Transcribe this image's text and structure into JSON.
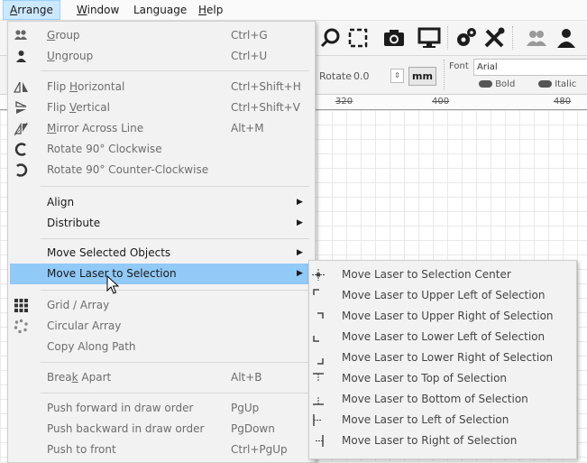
{
  "menubar": {
    "items": [
      {
        "label": "Arrange",
        "mnemonic": "A",
        "rest": "rrange"
      },
      {
        "label": "Window",
        "mnemonic": "W",
        "rest": "indow"
      },
      {
        "label": "Language"
      },
      {
        "label": "Help",
        "mnemonic": "H",
        "rest": "elp"
      }
    ]
  },
  "props": {
    "rotate_label": "Rotate",
    "rotate_value": "0.0",
    "unit_button": "mm",
    "font_label": "Font",
    "font_value": "Arial",
    "bold_label": "Bold",
    "italic_label": "Italic"
  },
  "ruler": {
    "ticks": [
      "320",
      "400",
      "480"
    ]
  },
  "arrange_menu": {
    "items": [
      {
        "pre": "",
        "mn": "G",
        "post": "roup",
        "shortcut": "Ctrl+G",
        "icon": "group-icon",
        "disabled": true
      },
      {
        "pre": "",
        "mn": "U",
        "post": "ngroup",
        "shortcut": "Ctrl+U",
        "icon": "ungroup-icon",
        "disabled": true
      },
      {
        "pre": "Flip ",
        "mn": "H",
        "post": "orizontal",
        "shortcut": "Ctrl+Shift+H",
        "icon": "flip-horizontal-icon",
        "disabled": true
      },
      {
        "pre": "Flip ",
        "mn": "V",
        "post": "ertical",
        "shortcut": "Ctrl+Shift+V",
        "icon": "flip-vertical-icon",
        "disabled": true
      },
      {
        "pre": "",
        "mn": "M",
        "post": "irror Across Line",
        "shortcut": "Alt+M",
        "icon": "mirror-icon",
        "disabled": true
      },
      {
        "pre": "Rotate 90° Clockwise",
        "mn": "",
        "post": "",
        "shortcut": "",
        "icon": "rotate-clockwise-icon",
        "disabled": true
      },
      {
        "pre": "Rotate 90° Counter-Clockwise",
        "mn": "",
        "post": "",
        "shortcut": "",
        "icon": "rotate-counter-clockwise-icon",
        "disabled": true
      },
      {
        "pre": "Align",
        "mn": "",
        "post": "",
        "shortcut": "",
        "icon": "",
        "disabled": false,
        "submenu": true
      },
      {
        "pre": "Distribute",
        "mn": "",
        "post": "",
        "shortcut": "",
        "icon": "",
        "disabled": false,
        "submenu": true
      },
      {
        "pre": "Move Selected Objects",
        "mn": "",
        "post": "",
        "shortcut": "",
        "icon": "",
        "disabled": false,
        "submenu": true
      },
      {
        "pre": "Move Laser to Selection",
        "mn": "",
        "post": "",
        "shortcut": "",
        "icon": "",
        "disabled": false,
        "submenu": true,
        "highlighted": true
      },
      {
        "pre": "Grid / Array",
        "mn": "",
        "post": "",
        "shortcut": "",
        "icon": "grid-array-icon",
        "disabled": true
      },
      {
        "pre": "Circular Array",
        "mn": "",
        "post": "",
        "shortcut": "",
        "icon": "circular-array-icon",
        "disabled": true
      },
      {
        "pre": "Copy Along Path",
        "mn": "",
        "post": "",
        "shortcut": "",
        "icon": "",
        "disabled": true
      },
      {
        "pre": "Brea",
        "mn": "k",
        "post": " Apart",
        "shortcut": "Alt+B",
        "icon": "",
        "disabled": true
      },
      {
        "pre": "Push forward in draw order",
        "mn": "",
        "post": "",
        "shortcut": "PgUp",
        "icon": "",
        "disabled": true
      },
      {
        "pre": "Push backward in draw order",
        "mn": "",
        "post": "",
        "shortcut": "PgDown",
        "icon": "",
        "disabled": true
      },
      {
        "pre": "Push to front",
        "mn": "",
        "post": "",
        "shortcut": "Ctrl+PgUp",
        "icon": "",
        "disabled": true
      }
    ]
  },
  "laser_submenu": {
    "items": [
      {
        "label": "Move Laser to Selection Center",
        "icon": "center-icon"
      },
      {
        "label": "Move Laser to Upper Left of Selection",
        "icon": "upper-left-icon"
      },
      {
        "label": "Move Laser to Upper Right of Selection",
        "icon": "upper-right-icon"
      },
      {
        "label": "Move Laser to Lower Left of Selection",
        "icon": "lower-left-icon"
      },
      {
        "label": "Move Laser to Lower Right of Selection",
        "icon": "lower-right-icon"
      },
      {
        "label": "Move Laser to Top of Selection",
        "icon": "top-icon"
      },
      {
        "label": "Move Laser to Bottom of Selection",
        "icon": "bottom-icon"
      },
      {
        "label": "Move Laser to Left of Selection",
        "icon": "left-icon"
      },
      {
        "label": "Move Laser to Right of Selection",
        "icon": "right-icon"
      }
    ]
  },
  "colors": {
    "menu_highlight": "#91c9f7",
    "menubar_active": "#cce8ff",
    "disabled_text": "#6d6d6d"
  }
}
